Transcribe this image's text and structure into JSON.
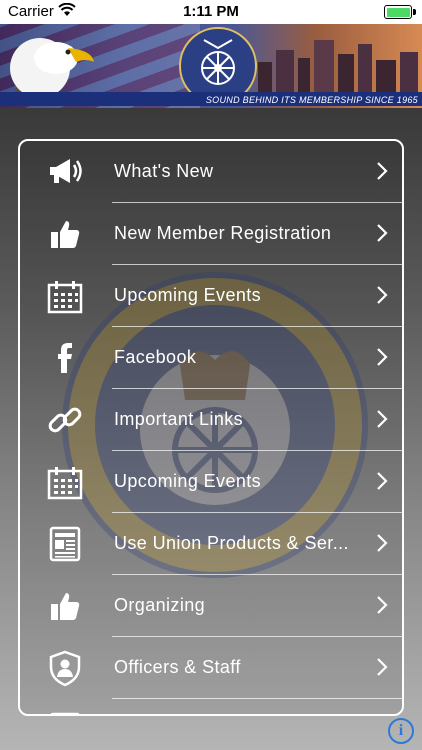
{
  "status_bar": {
    "carrier": "Carrier",
    "time": "1:11 PM"
  },
  "banner": {
    "tagline": "SOUND BEHIND ITS MEMBERSHIP SINCE 1965",
    "seal_top_text": "TEAMSTERS LOCAL 480",
    "seal_bottom_text": "NASHVILLE, TENNESSEE"
  },
  "menu": {
    "items": [
      {
        "label": "What's New",
        "icon": "megaphone-icon"
      },
      {
        "label": "New Member Registration",
        "icon": "thumbs-up-icon"
      },
      {
        "label": "Upcoming Events",
        "icon": "calendar-icon"
      },
      {
        "label": "Facebook",
        "icon": "facebook-icon"
      },
      {
        "label": "Important Links",
        "icon": "link-icon"
      },
      {
        "label": "Upcoming Events",
        "icon": "calendar-icon"
      },
      {
        "label": "Use Union Products & Ser...",
        "icon": "newspaper-icon"
      },
      {
        "label": "Organizing",
        "icon": "thumbs-up-icon"
      },
      {
        "label": "Officers & Staff",
        "icon": "shield-person-icon"
      }
    ]
  },
  "colors": {
    "accent": "#2a7ad8",
    "battery": "#4cd964",
    "banner_blue": "#1b2f7a"
  }
}
